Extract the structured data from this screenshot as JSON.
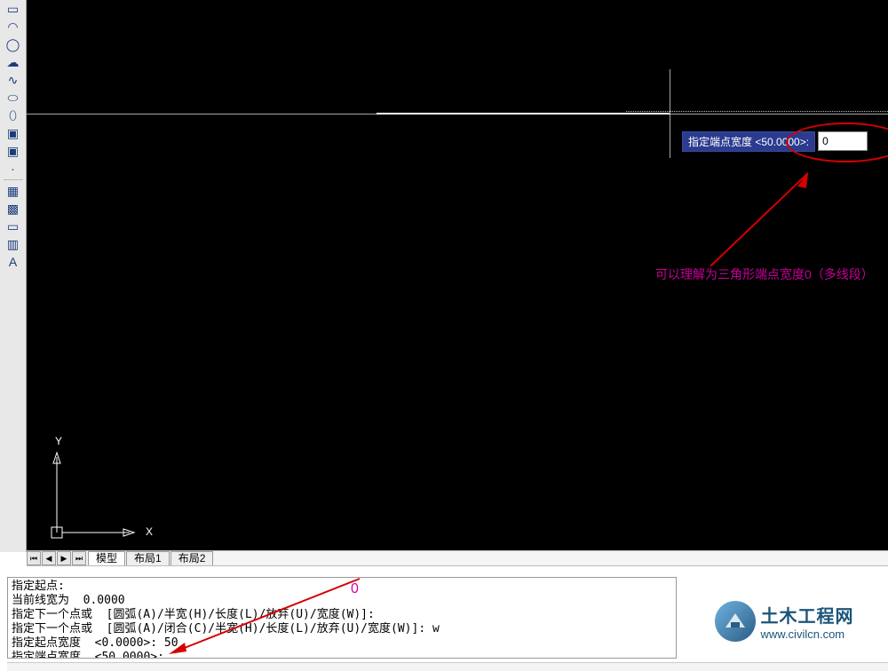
{
  "toolbar": {
    "rectangle": "▭",
    "arc": "◠",
    "circle": "◯",
    "revcloud": "☁",
    "spline": "∿",
    "ellipse": "⬭",
    "ellipse_arc": "⬯",
    "block": "▣",
    "point": "·",
    "hatch1": "▦",
    "hatch2": "▩",
    "region": "▭",
    "table": "▥",
    "mtext": "A"
  },
  "dyn_prompt": {
    "label": "指定端点宽度 <50.0000>:",
    "value": "0"
  },
  "annotation": "可以理解为三角形端点宽度0（多线段）",
  "ucs": {
    "y": "Y",
    "x": "X"
  },
  "tabs": {
    "nav": {
      "first": "⏮",
      "prev": "◀",
      "next": "▶",
      "last": "⏭"
    },
    "model": "模型",
    "layout1": "布局1",
    "layout2": "布局2"
  },
  "cmd_history": {
    "l1": "指定起点:",
    "l2": "当前线宽为  0.0000",
    "l3": "指定下一个点或  [圆弧(A)/半宽(H)/长度(L)/放弃(U)/宽度(W)]:",
    "l4": "指定下一个点或  [圆弧(A)/闭合(C)/半宽(H)/长度(L)/放弃(U)/宽度(W)]: w",
    "l5": "指定起点宽度  <0.0000>: 50",
    "l6": "指定端点宽度  <50.0000>:"
  },
  "zero_overlay": "0",
  "watermark": {
    "cn": "土木工程网",
    "en": "www.civilcn.com"
  }
}
